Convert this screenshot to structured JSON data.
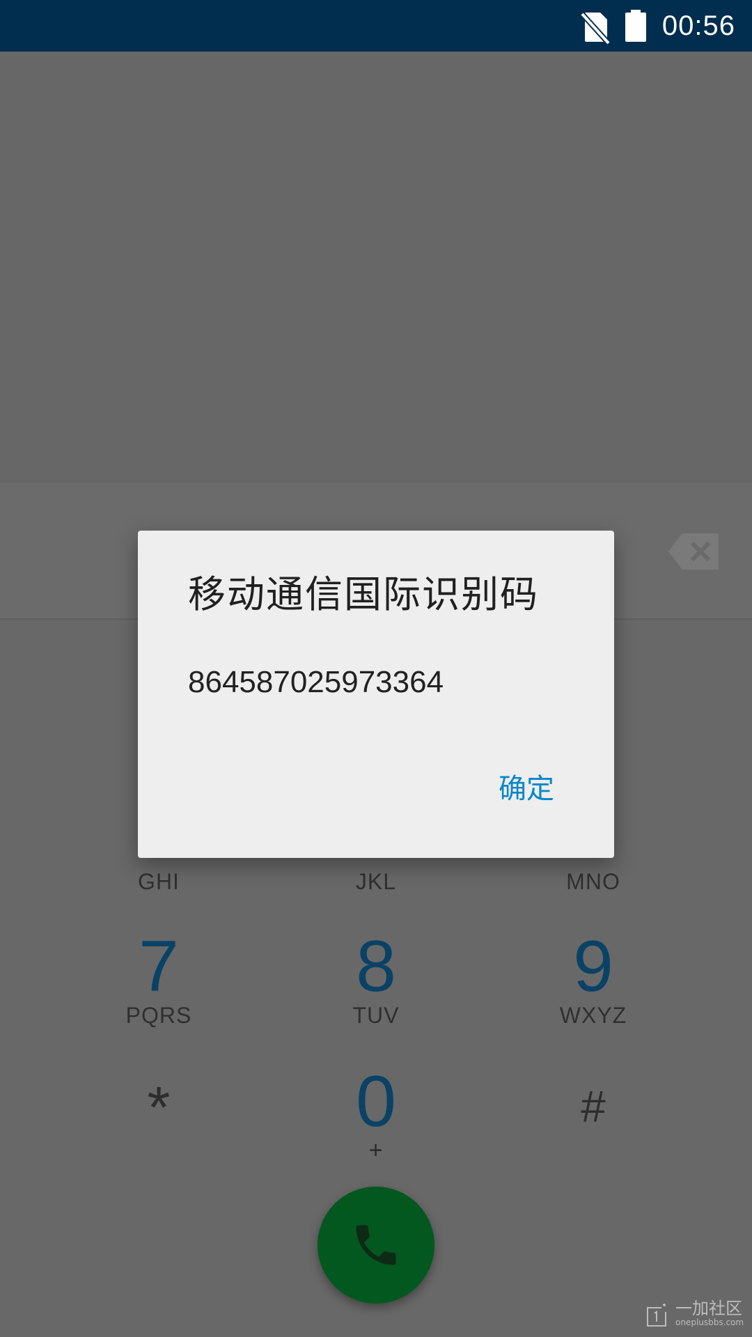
{
  "status_bar": {
    "time": "00:56",
    "icons": [
      "no-sim-icon",
      "battery-icon"
    ]
  },
  "dialpad": {
    "keys": [
      {
        "letters": "GHI"
      },
      {
        "letters": "JKL"
      },
      {
        "letters": "MNO"
      },
      {
        "digit": "7",
        "letters": "PQRS"
      },
      {
        "digit": "8",
        "letters": "TUV"
      },
      {
        "digit": "9",
        "letters": "WXYZ"
      },
      {
        "digit": "*"
      },
      {
        "digit": "0",
        "letters": "+"
      },
      {
        "digit": "#"
      }
    ]
  },
  "dialog": {
    "title": "移动通信国际识别码",
    "message": "864587025973364",
    "ok_label": "确定"
  },
  "watermark": {
    "text_cn": "一加社区",
    "text_en": "oneplusbbs.com"
  },
  "colors": {
    "status_bar": "#012d4e",
    "digit": "#0a4266",
    "call_button": "#03581f",
    "dialog_action": "#0a86c8"
  }
}
